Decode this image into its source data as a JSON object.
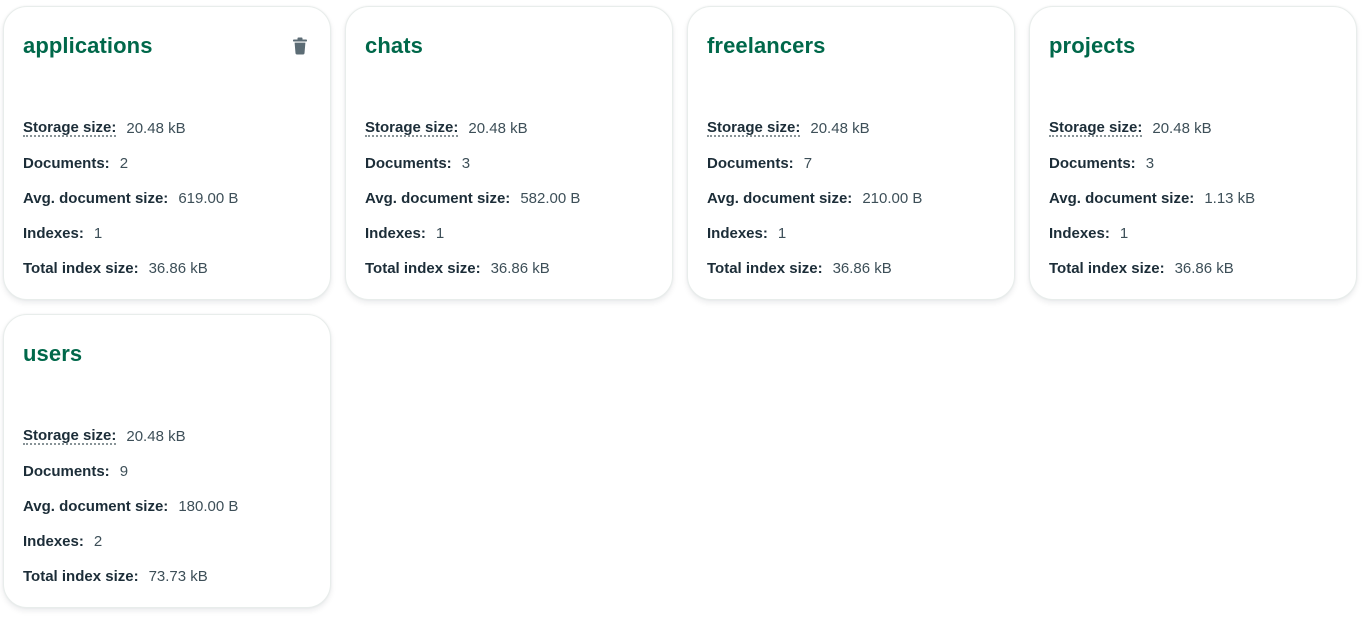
{
  "labels": {
    "storage": "Storage size:",
    "documents": "Documents:",
    "avg": "Avg. document size:",
    "indexes": "Indexes:",
    "total": "Total index size:"
  },
  "collections": [
    {
      "name": "applications",
      "storage_size": "20.48 kB",
      "documents": "2",
      "avg_document_size": "619.00 B",
      "indexes": "1",
      "total_index_size": "36.86 kB"
    },
    {
      "name": "chats",
      "storage_size": "20.48 kB",
      "documents": "3",
      "avg_document_size": "582.00 B",
      "indexes": "1",
      "total_index_size": "36.86 kB"
    },
    {
      "name": "freelancers",
      "storage_size": "20.48 kB",
      "documents": "7",
      "avg_document_size": "210.00 B",
      "indexes": "1",
      "total_index_size": "36.86 kB"
    },
    {
      "name": "projects",
      "storage_size": "20.48 kB",
      "documents": "3",
      "avg_document_size": "1.13 kB",
      "indexes": "1",
      "total_index_size": "36.86 kB"
    },
    {
      "name": "users",
      "storage_size": "20.48 kB",
      "documents": "9",
      "avg_document_size": "180.00 B",
      "indexes": "2",
      "total_index_size": "73.73 kB"
    }
  ],
  "colors": {
    "title": "#00684a",
    "text": "#1c2d38",
    "icon": "#5c6c75"
  },
  "icons": {
    "delete": "trash-icon"
  }
}
